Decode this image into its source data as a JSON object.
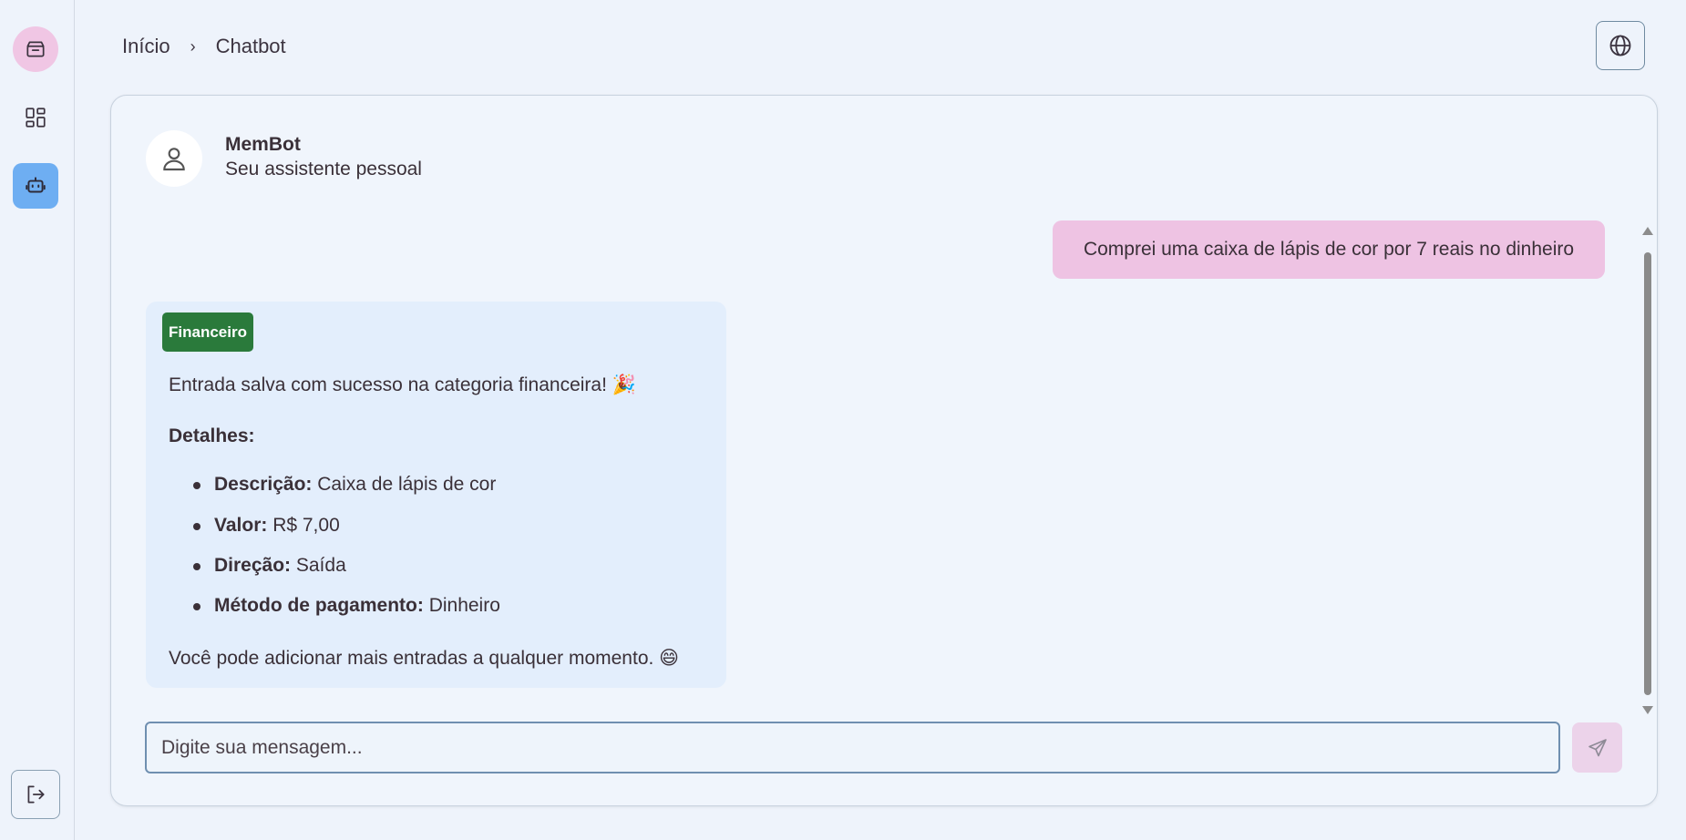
{
  "sidebar": {
    "items": [
      {
        "name": "package-icon"
      },
      {
        "name": "dashboard-icon"
      },
      {
        "name": "bot-icon"
      },
      {
        "name": "logout-icon"
      }
    ]
  },
  "breadcrumb": {
    "home": "Início",
    "separator": "›",
    "current": "Chatbot"
  },
  "header": {
    "language_icon": "globe-icon"
  },
  "chat": {
    "bot_name": "MemBot",
    "bot_subtitle": "Seu assistente pessoal",
    "messages": [
      {
        "role": "user",
        "text": "Comprei uma caixa de lápis de cor por 7 reais no dinheiro"
      },
      {
        "role": "bot",
        "tag": "Financeiro",
        "intro": "Entrada salva com sucesso na categoria financeira! 🎉",
        "details_title": "Detalhes:",
        "details": [
          {
            "label": "Descrição:",
            "value": "Caixa de lápis de cor"
          },
          {
            "label": "Valor:",
            "value": "R$ 7,00"
          },
          {
            "label": "Direção:",
            "value": "Saída"
          },
          {
            "label": "Método de pagamento:",
            "value": "Dinheiro"
          }
        ],
        "outro": "Você pode adicionar mais entradas a qualquer momento. 😄"
      }
    ]
  },
  "composer": {
    "placeholder": "Digite sua mensagem...",
    "value": ""
  },
  "colors": {
    "user_bubble": "#eec3e3",
    "bot_bubble": "#e3eefc",
    "tag": "#2a7a3b",
    "accent_bot": "#6eaef2"
  }
}
